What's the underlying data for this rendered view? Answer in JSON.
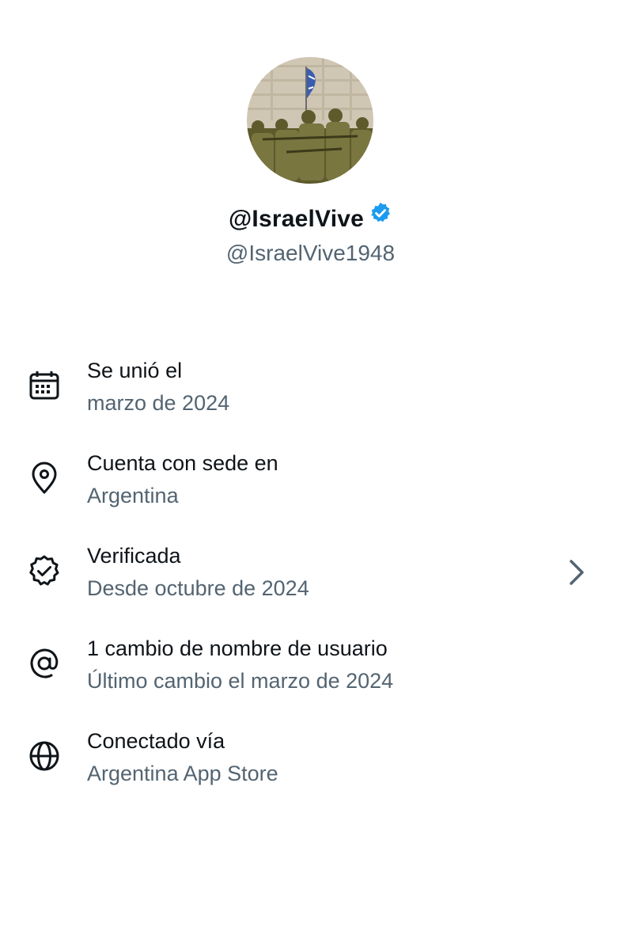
{
  "profile": {
    "display_name": "@IsraelVive",
    "handle": "@IsraelVive1948",
    "verified_color": "#1d9bf0"
  },
  "info": [
    {
      "icon": "calendar-icon",
      "title": "Se unió el",
      "subtitle": "marzo de 2024"
    },
    {
      "icon": "location-pin-icon",
      "title": "Cuenta con sede en",
      "subtitle": "Argentina"
    },
    {
      "icon": "verified-badge-icon",
      "title": "Verificada",
      "subtitle": "Desde octubre de 2024",
      "has_chevron": true
    },
    {
      "icon": "at-sign-icon",
      "title": "1 cambio de nombre de usuario",
      "subtitle": "Último cambio el marzo de 2024"
    },
    {
      "icon": "globe-icon",
      "title": "Conectado vía",
      "subtitle": "Argentina App Store"
    }
  ],
  "colors": {
    "primary_text": "#0f1419",
    "secondary_text": "#536471"
  }
}
